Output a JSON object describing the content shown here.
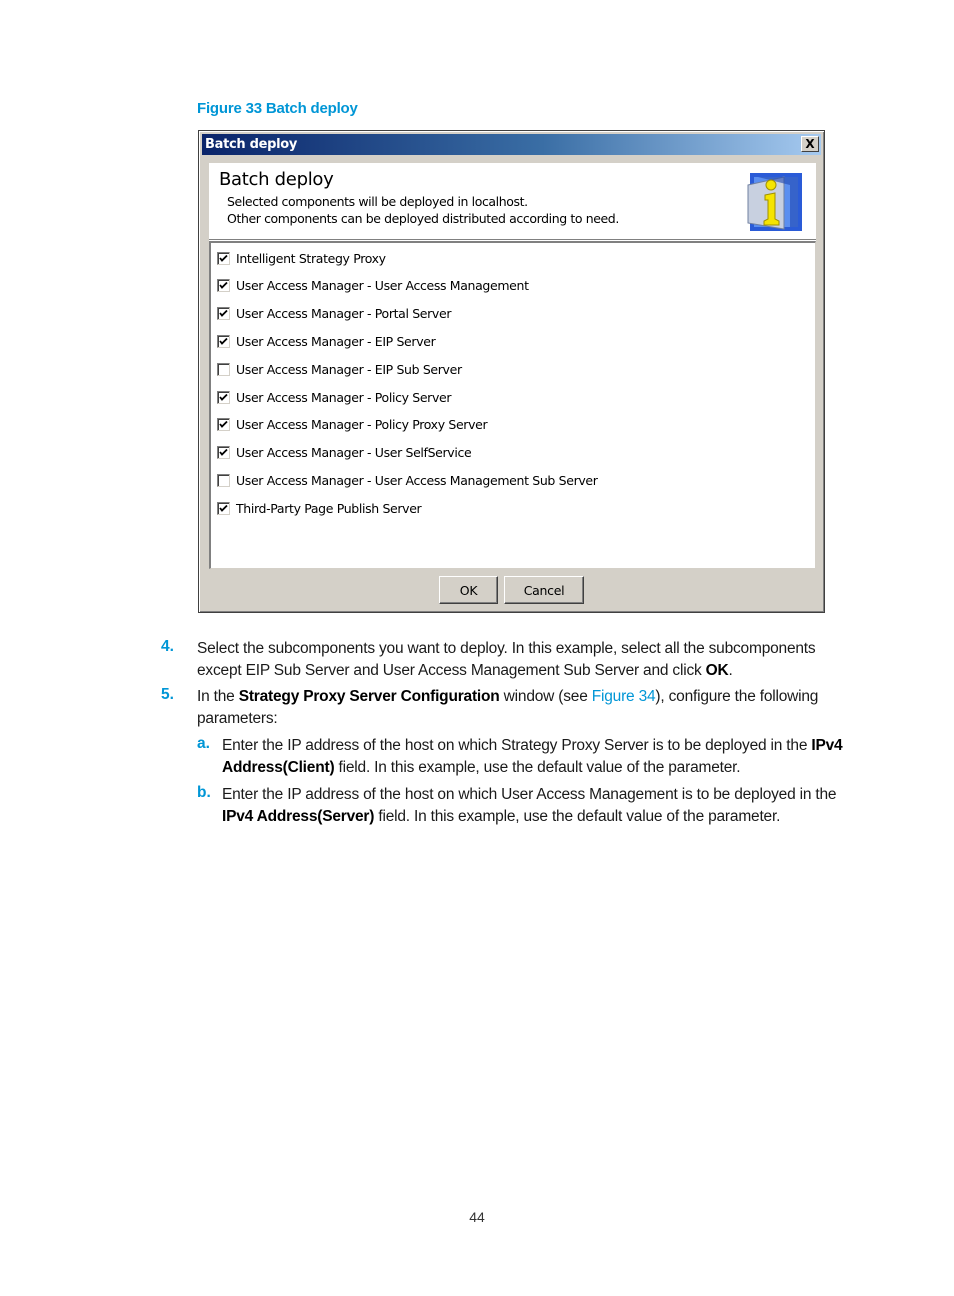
{
  "figure_caption": "Figure 33 Batch deploy",
  "dialog": {
    "title": "Batch deploy",
    "close_label": "X",
    "header": {
      "title": "Batch deploy",
      "line1": "Selected components will be deployed in localhost.",
      "line2": "Other components can be deployed distributed according to need.",
      "icon": "info-icon"
    },
    "components": [
      {
        "label": "Intelligent Strategy Proxy",
        "checked": true
      },
      {
        "label": "User Access Manager - User Access Management",
        "checked": true
      },
      {
        "label": "User Access Manager - Portal Server",
        "checked": true
      },
      {
        "label": "User Access Manager - EIP Server",
        "checked": true
      },
      {
        "label": "User Access Manager - EIP Sub Server",
        "checked": false
      },
      {
        "label": "User Access Manager - Policy Server",
        "checked": true
      },
      {
        "label": "User Access Manager - Policy Proxy Server",
        "checked": true
      },
      {
        "label": "User Access Manager - User SelfService",
        "checked": true
      },
      {
        "label": "User Access Manager - User Access Management Sub Server",
        "checked": false
      },
      {
        "label": "Third-Party Page Publish Server",
        "checked": true
      }
    ],
    "ok_label": "OK",
    "cancel_label": "Cancel"
  },
  "steps": {
    "s4": {
      "num": "4.",
      "line1": "Select the subcomponents you want to deploy. In this example, select all the subcomponents",
      "line2_pre": "except EIP Sub Server and User Access Management Sub Server and click ",
      "line2_bold": "OK",
      "line2_post": "."
    },
    "s5": {
      "num": "5.",
      "pre": "In the ",
      "bold": "Strategy Proxy Server Configuration",
      "mid": " window (see ",
      "link": "Figure 34",
      "post": "), configure the following",
      "line2": "parameters:"
    },
    "sa": {
      "num": "a.",
      "line1_pre": "Enter the IP address of the host on which Strategy Proxy Server is to be deployed in the ",
      "line1_bold": "IPv4",
      "line2_bold": "Address(Client)",
      "line2_post": " field. In this example, use the default value of the parameter."
    },
    "sb": {
      "num": "b.",
      "line1": "Enter the IP address of the host on which User Access Management is to be deployed in the",
      "line2_bold": "IPv4 Address(Server)",
      "line2_post": " field. In this example, use the default value of the parameter."
    }
  },
  "page_number": "44"
}
